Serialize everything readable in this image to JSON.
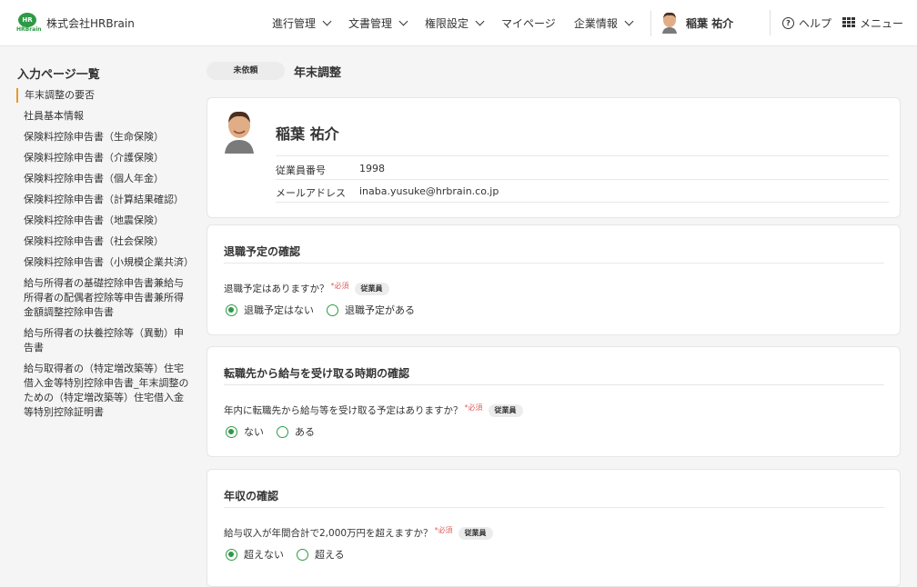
{
  "header": {
    "logo_text": "HR",
    "logo_sub": "HRBrain",
    "company": "株式会社HRBrain",
    "nav": [
      "進行管理",
      "文書管理",
      "権限設定",
      "マイページ",
      "企業情報"
    ],
    "nav_has_chevron": [
      true,
      true,
      true,
      false,
      true
    ],
    "user_name": "稲葉 祐介",
    "help": "ヘルプ",
    "menu": "メニュー"
  },
  "sidebar": {
    "title": "入力ページ一覧",
    "items": [
      "年末調整の要否",
      "社員基本情報",
      "保険料控除申告書（生命保険）",
      "保険料控除申告書（介護保険）",
      "保険料控除申告書（個人年金）",
      "保険料控除申告書（計算結果確認）",
      "保険料控除申告書（地震保険）",
      "保険料控除申告書（社会保険）",
      "保険料控除申告書（小規模企業共済）",
      "給与所得者の基礎控除申告書兼給与所得者の配偶者控除等申告書兼所得金額調整控除申告書",
      "給与所得者の扶養控除等（異動）申告書",
      "給与取得者の（特定増改築等）住宅借入金等特別控除申告書_年末調整のための（特定増改築等）住宅借入金等特別控除証明書"
    ],
    "active_index": 0
  },
  "main": {
    "status_badge": "未依頼",
    "page_title": "年末調整",
    "profile": {
      "name": "稲葉 祐介",
      "employee_no_label": "従業員番号",
      "employee_no": "1998",
      "email_label": "メールアドレス",
      "email": "inaba.yusuke@hrbrain.co.jp"
    },
    "sections": [
      {
        "title": "退職予定の確認",
        "question": "退職予定はありますか？",
        "required": "*必須",
        "role": "従業員",
        "options": [
          "退職予定はない",
          "退職予定がある"
        ],
        "selected": 0
      },
      {
        "title": "転職先から給与を受け取る時期の確認",
        "question": "年内に転職先から給与等を受け取る予定はありますか？",
        "required": "*必須",
        "role": "従業員",
        "options": [
          "ない",
          "ある"
        ],
        "selected": 0
      },
      {
        "title": "年収の確認",
        "question": "給与収入が年間合計で2,000万円を超えますか？",
        "required": "*必須",
        "role": "従業員",
        "options": [
          "超えない",
          "超える"
        ],
        "selected": 0
      }
    ]
  },
  "colors": {
    "brand_green": "#2f9a46",
    "active_marker": "#e89a2c",
    "required_red": "#e06060"
  }
}
